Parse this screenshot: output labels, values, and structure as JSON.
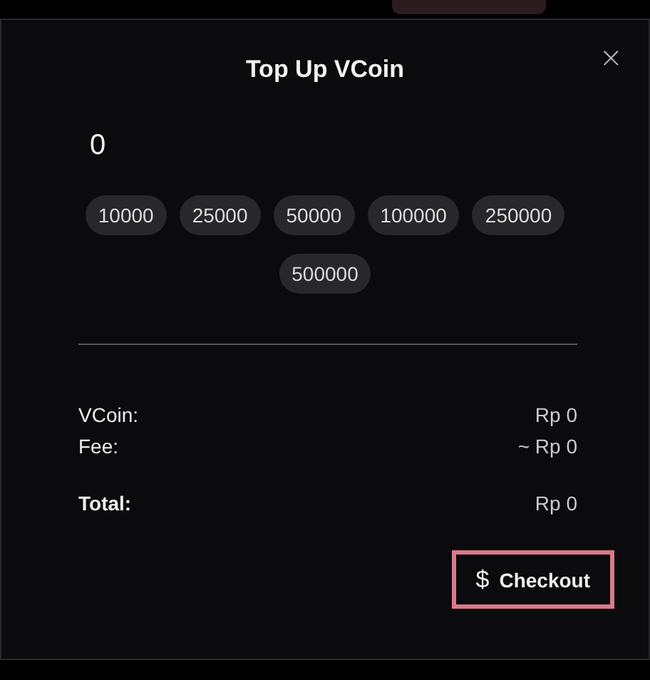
{
  "dialog": {
    "title": "Top Up VCoin",
    "close_icon": "×"
  },
  "amount_input": {
    "value": "0"
  },
  "presets": [
    "10000",
    "25000",
    "50000",
    "100000",
    "250000",
    "500000"
  ],
  "summary": [
    {
      "kind": "line",
      "label": "VCoin:",
      "value": "Rp 0"
    },
    {
      "kind": "line",
      "label": "Fee:",
      "value": "~ Rp 0"
    },
    {
      "kind": "total",
      "label": "Total:",
      "value": "Rp 0"
    }
  ],
  "checkout_button": {
    "icon": "$",
    "label": "Checkout"
  }
}
